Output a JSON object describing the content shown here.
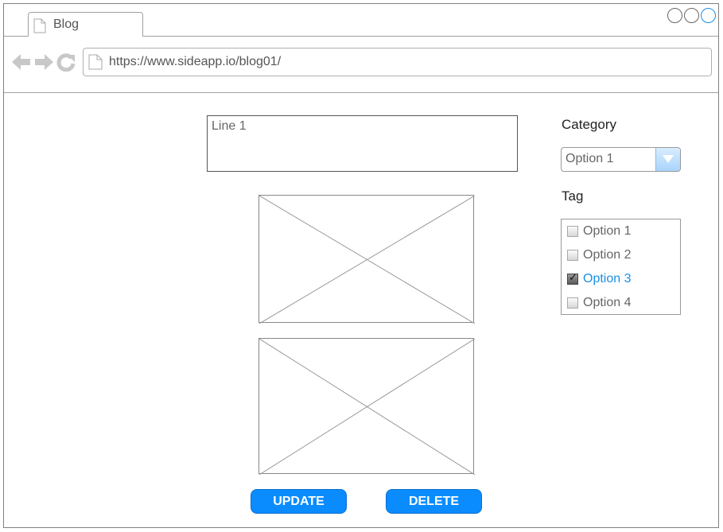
{
  "browser": {
    "tab_title": "Blog",
    "url": "https://www.sideapp.io/blog01/",
    "window_controls": [
      "minimize",
      "maximize",
      "close"
    ],
    "nav_icons": [
      "back-arrow-icon",
      "forward-arrow-icon",
      "reload-icon"
    ]
  },
  "editor": {
    "text_value": "Line 1"
  },
  "sidebar": {
    "category_label": "Category",
    "category_selected": "Option 1",
    "tag_label": "Tag",
    "tags": [
      {
        "label": "Option 1",
        "checked": false
      },
      {
        "label": "Option 2",
        "checked": false
      },
      {
        "label": "Option 3",
        "checked": true
      },
      {
        "label": "Option 4",
        "checked": false
      }
    ]
  },
  "actions": {
    "update_label": "UPDATE",
    "delete_label": "DELETE"
  },
  "colors": {
    "accent": "#0a8cff",
    "selected_text": "#1a8fe3"
  }
}
